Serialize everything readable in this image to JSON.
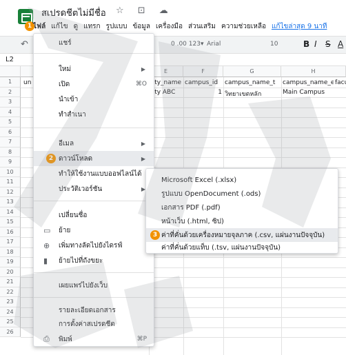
{
  "app": {
    "title": "สเปรดชีตไม่มีชื่อ",
    "title_icons": "☆ ⊡ ☁",
    "accent": "#188038",
    "badge_color": "#f29200"
  },
  "menubar": {
    "items": [
      "ไฟล์",
      "แก้ไข",
      "ดู",
      "แทรก",
      "รูปแบบ",
      "ข้อมูล",
      "เครื่องมือ",
      "ส่วนเสริม",
      "ความช่วยเหลือ"
    ],
    "last_edit": "แก้ไขล่าสุด 9 นาที"
  },
  "toolbar": {
    "undo": "↶",
    "number_formats": "0 .00 123▾",
    "font": "Arial",
    "font_size": "10",
    "bold": "B",
    "italic": "I",
    "strike": "S",
    "text_color": "A"
  },
  "namebox": "L2",
  "grid": {
    "columns": [
      "E",
      "F",
      "G",
      "H"
    ],
    "rows": [
      "1",
      "2",
      "3",
      "4",
      "5",
      "6",
      "7",
      "8",
      "9",
      "10",
      "11",
      "12",
      "13",
      "14",
      "15",
      "16",
      "17",
      "18",
      "19",
      "20",
      "21",
      "22",
      "23",
      "24",
      "25",
      "26"
    ],
    "cells": {
      "a1": "un",
      "e1": "sity_name",
      "f1": "campus_id",
      "g1": "campus_name_t",
      "h1": "campus_name_e",
      "i1": "facu",
      "e2": "sity ABC",
      "f2": "1",
      "g2": "วิทยาเขตหลัก",
      "h2": "Main Campus"
    }
  },
  "file_menu": {
    "share": "แชร์",
    "new": "ใหม่",
    "open": "เปิด",
    "open_shortcut": "⌘O",
    "import": "นำเข้า",
    "make_copy": "ทำสำเนา",
    "email": "อีเมล",
    "download": "ดาวน์โหลด",
    "offline": "ทำให้ใช้งานแบบออฟไลน์ได้",
    "version_history": "ประวัติเวอร์ชัน",
    "rename": "เปลี่ยนชื่อ",
    "move": "ย้าย",
    "add_shortcut": "เพิ่มทางลัดไปยังไดรฟ์",
    "trash": "ย้ายไปที่ถังขยะ",
    "publish": "เผยแพร่ไปยังเว็บ",
    "details": "รายละเอียดเอกสาร",
    "settings": "การตั้งค่าสเปรดชีต",
    "print": "พิมพ์",
    "print_shortcut": "⌘P"
  },
  "download_menu": {
    "xlsx": "Microsoft Excel (.xlsx)",
    "ods": "รูปแบบ OpenDocument (.ods)",
    "pdf": "เอกสาร PDF (.pdf)",
    "html": "หน้าเว็บ (.html, ซิป)",
    "csv": "ค่าที่คั่นด้วยเครื่องหมายจุลภาค (.csv, แผ่นงานปัจจุบัน)",
    "tsv": "ค่าที่คั่นด้วยแท็บ (.tsv, แผ่นงานปัจจุบัน)"
  },
  "steps": {
    "one": "1",
    "two": "2",
    "three": "3"
  }
}
